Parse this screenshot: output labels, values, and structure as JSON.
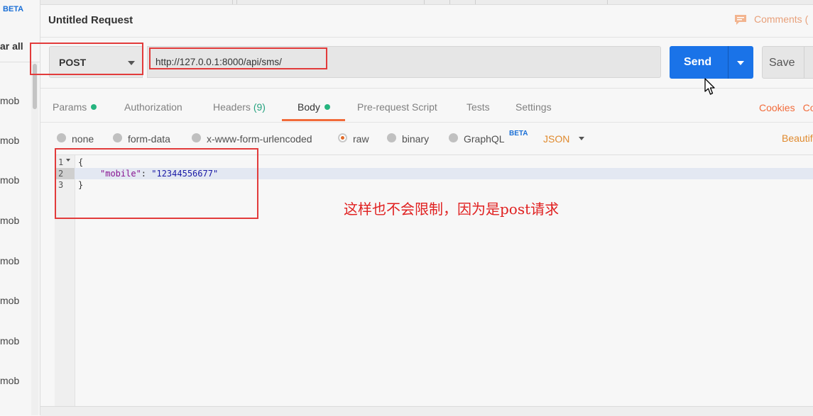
{
  "sidebar": {
    "beta_badge": "BETA",
    "clear_all": "ar all",
    "items": [
      "mob",
      "mob",
      "mob",
      "mob",
      "mob",
      "mob",
      "mob",
      "mob"
    ]
  },
  "request": {
    "title": "Untitled Request",
    "comments_label": "Comments (",
    "method": "POST",
    "url": "http://127.0.0.1:8000/api/sms/",
    "send_label": "Send",
    "save_label": "Save"
  },
  "tabs": {
    "params": "Params",
    "authorization": "Authorization",
    "headers": "Headers",
    "headers_count": "(9)",
    "body": "Body",
    "pre_request_script": "Pre-request Script",
    "tests": "Tests",
    "settings": "Settings",
    "cookies": "Cookies",
    "code_link": "Co",
    "active": "Body"
  },
  "body_types": {
    "none": "none",
    "form_data": "form-data",
    "urlencoded": "x-www-form-urlencoded",
    "raw": "raw",
    "binary": "binary",
    "graphql": "GraphQL",
    "graphql_badge": "BETA",
    "selected": "raw",
    "format": "JSON",
    "beautify": "Beautif"
  },
  "editor": {
    "line_numbers": [
      "1",
      "2",
      "3"
    ],
    "open_brace": "{",
    "key": "\"mobile\"",
    "colon": ": ",
    "value": "\"12344556677\"",
    "close_brace": "}"
  },
  "annotation": "这样也不会限制，因为是post请求",
  "colors": {
    "send_button": "#1a73e8",
    "accent_orange": "#f26b3a",
    "annotation_red": "#e02020",
    "status_dot_green": "#26b47f"
  }
}
